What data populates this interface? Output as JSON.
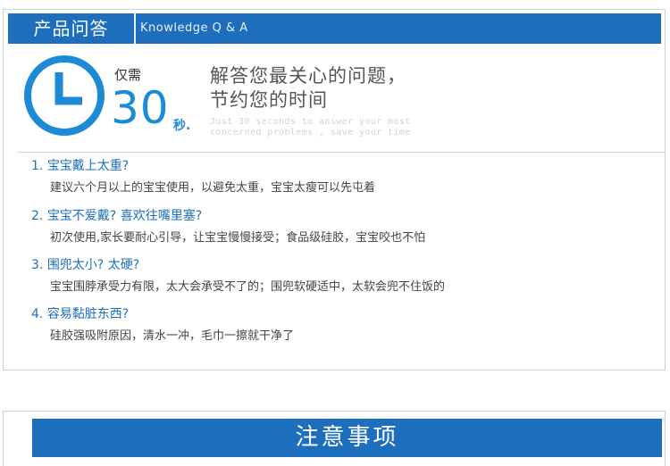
{
  "qa_section": {
    "title": "产品问答",
    "subtitle": "Knowledge Q & A",
    "only_label": "仅需",
    "number": "30",
    "unit": "秒.",
    "headline_line1": "解答您最关心的问题，",
    "headline_line2": "节约您的时间",
    "english_line1": "Just 30 seconds to answer your most",
    "english_line2": "concerned problems , save your time",
    "items": [
      {
        "number": "1.",
        "question": "宝宝戴上太重?",
        "answer": "建议六个月以上的宝宝使用，以避免太重，宝宝太瘦可以先屯着"
      },
      {
        "number": "2.",
        "question": "宝宝不爱戴?  喜欢往嘴里塞?",
        "answer": "初次使用,家长要耐心引导，让宝宝慢慢接受；食品级硅胶，宝宝咬也不怕"
      },
      {
        "number": "3.",
        "question": "围兜太小?  太硬?",
        "answer": "宝宝围脖承受力有限，太大会承受不了的；围兜软硬适中，太软会兜不住饭的"
      },
      {
        "number": "4.",
        "question": "容易黏脏东西?",
        "answer": "硅胶强吸附原因，清水一冲，毛巾一擦就干净了"
      }
    ]
  },
  "notice_section": {
    "title": "注意事项"
  },
  "colors": {
    "brand_blue": "#1d6fbe",
    "accent_blue": "#1d8ad6"
  },
  "icons": {
    "clock": "clock-icon"
  }
}
